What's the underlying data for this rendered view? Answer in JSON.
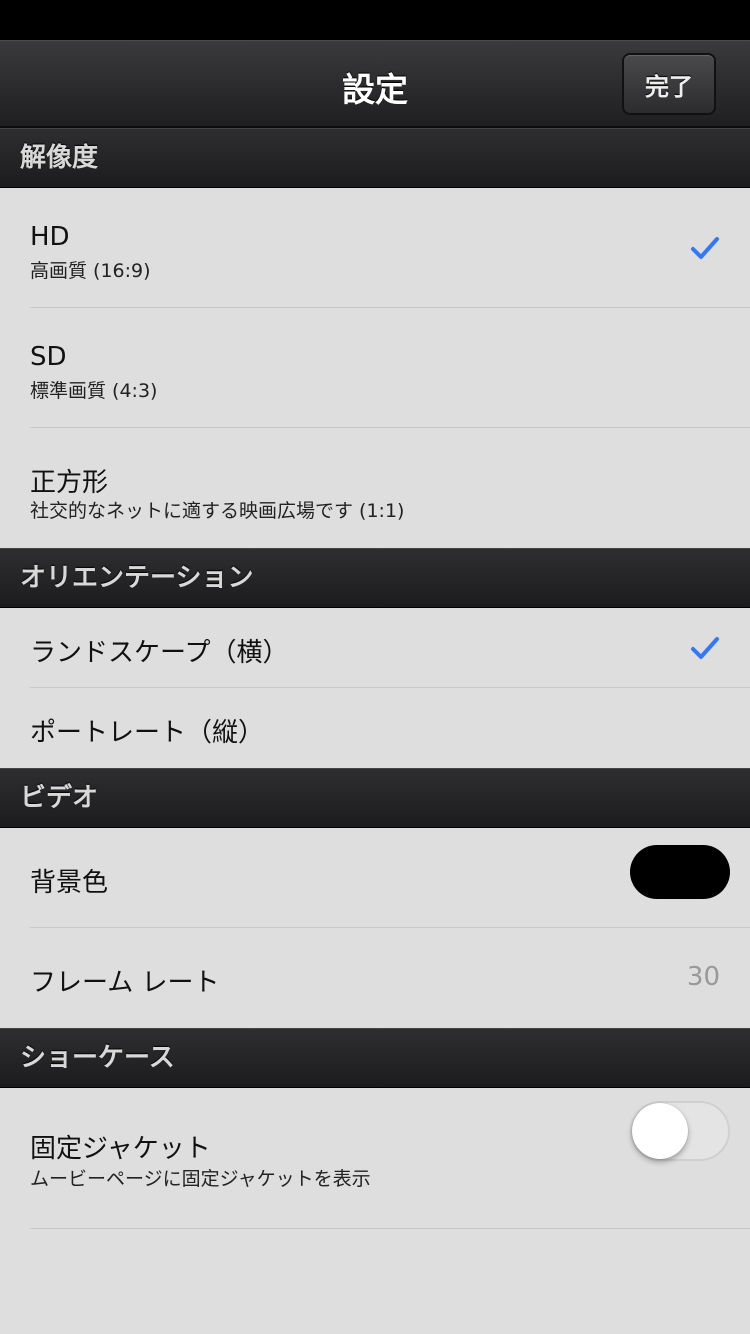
{
  "nav": {
    "title": "設定",
    "done_label": "完了"
  },
  "sections": {
    "resolution": {
      "header": "解像度",
      "items": [
        {
          "title": "HD",
          "subtitle": "高画質 (16:9)",
          "checked": true
        },
        {
          "title": "SD",
          "subtitle": "標準画質 (4:3)",
          "checked": false
        },
        {
          "title": "正方形",
          "subtitle": "社交的なネットに適する映画広場です (1:1)",
          "checked": false
        }
      ]
    },
    "orientation": {
      "header": "オリエンテーション",
      "items": [
        {
          "title": "ランドスケープ（横）",
          "checked": true
        },
        {
          "title": "ポートレート（縦）",
          "checked": false
        }
      ]
    },
    "video": {
      "header": "ビデオ",
      "background_color": {
        "label": "背景色",
        "value": "#000000"
      },
      "frame_rate": {
        "label": "フレーム レート",
        "value": "30"
      }
    },
    "showcase": {
      "header": "ショーケース",
      "fixed_jacket": {
        "title": "固定ジャケット",
        "subtitle": "ムービーページに固定ジャケットを表示",
        "enabled": false
      }
    }
  },
  "colors": {
    "accent": "#3478f6",
    "section_header": "#1f1f21",
    "row_background": "#dedede"
  },
  "icons": {
    "checkmark": "checkmark-icon"
  }
}
